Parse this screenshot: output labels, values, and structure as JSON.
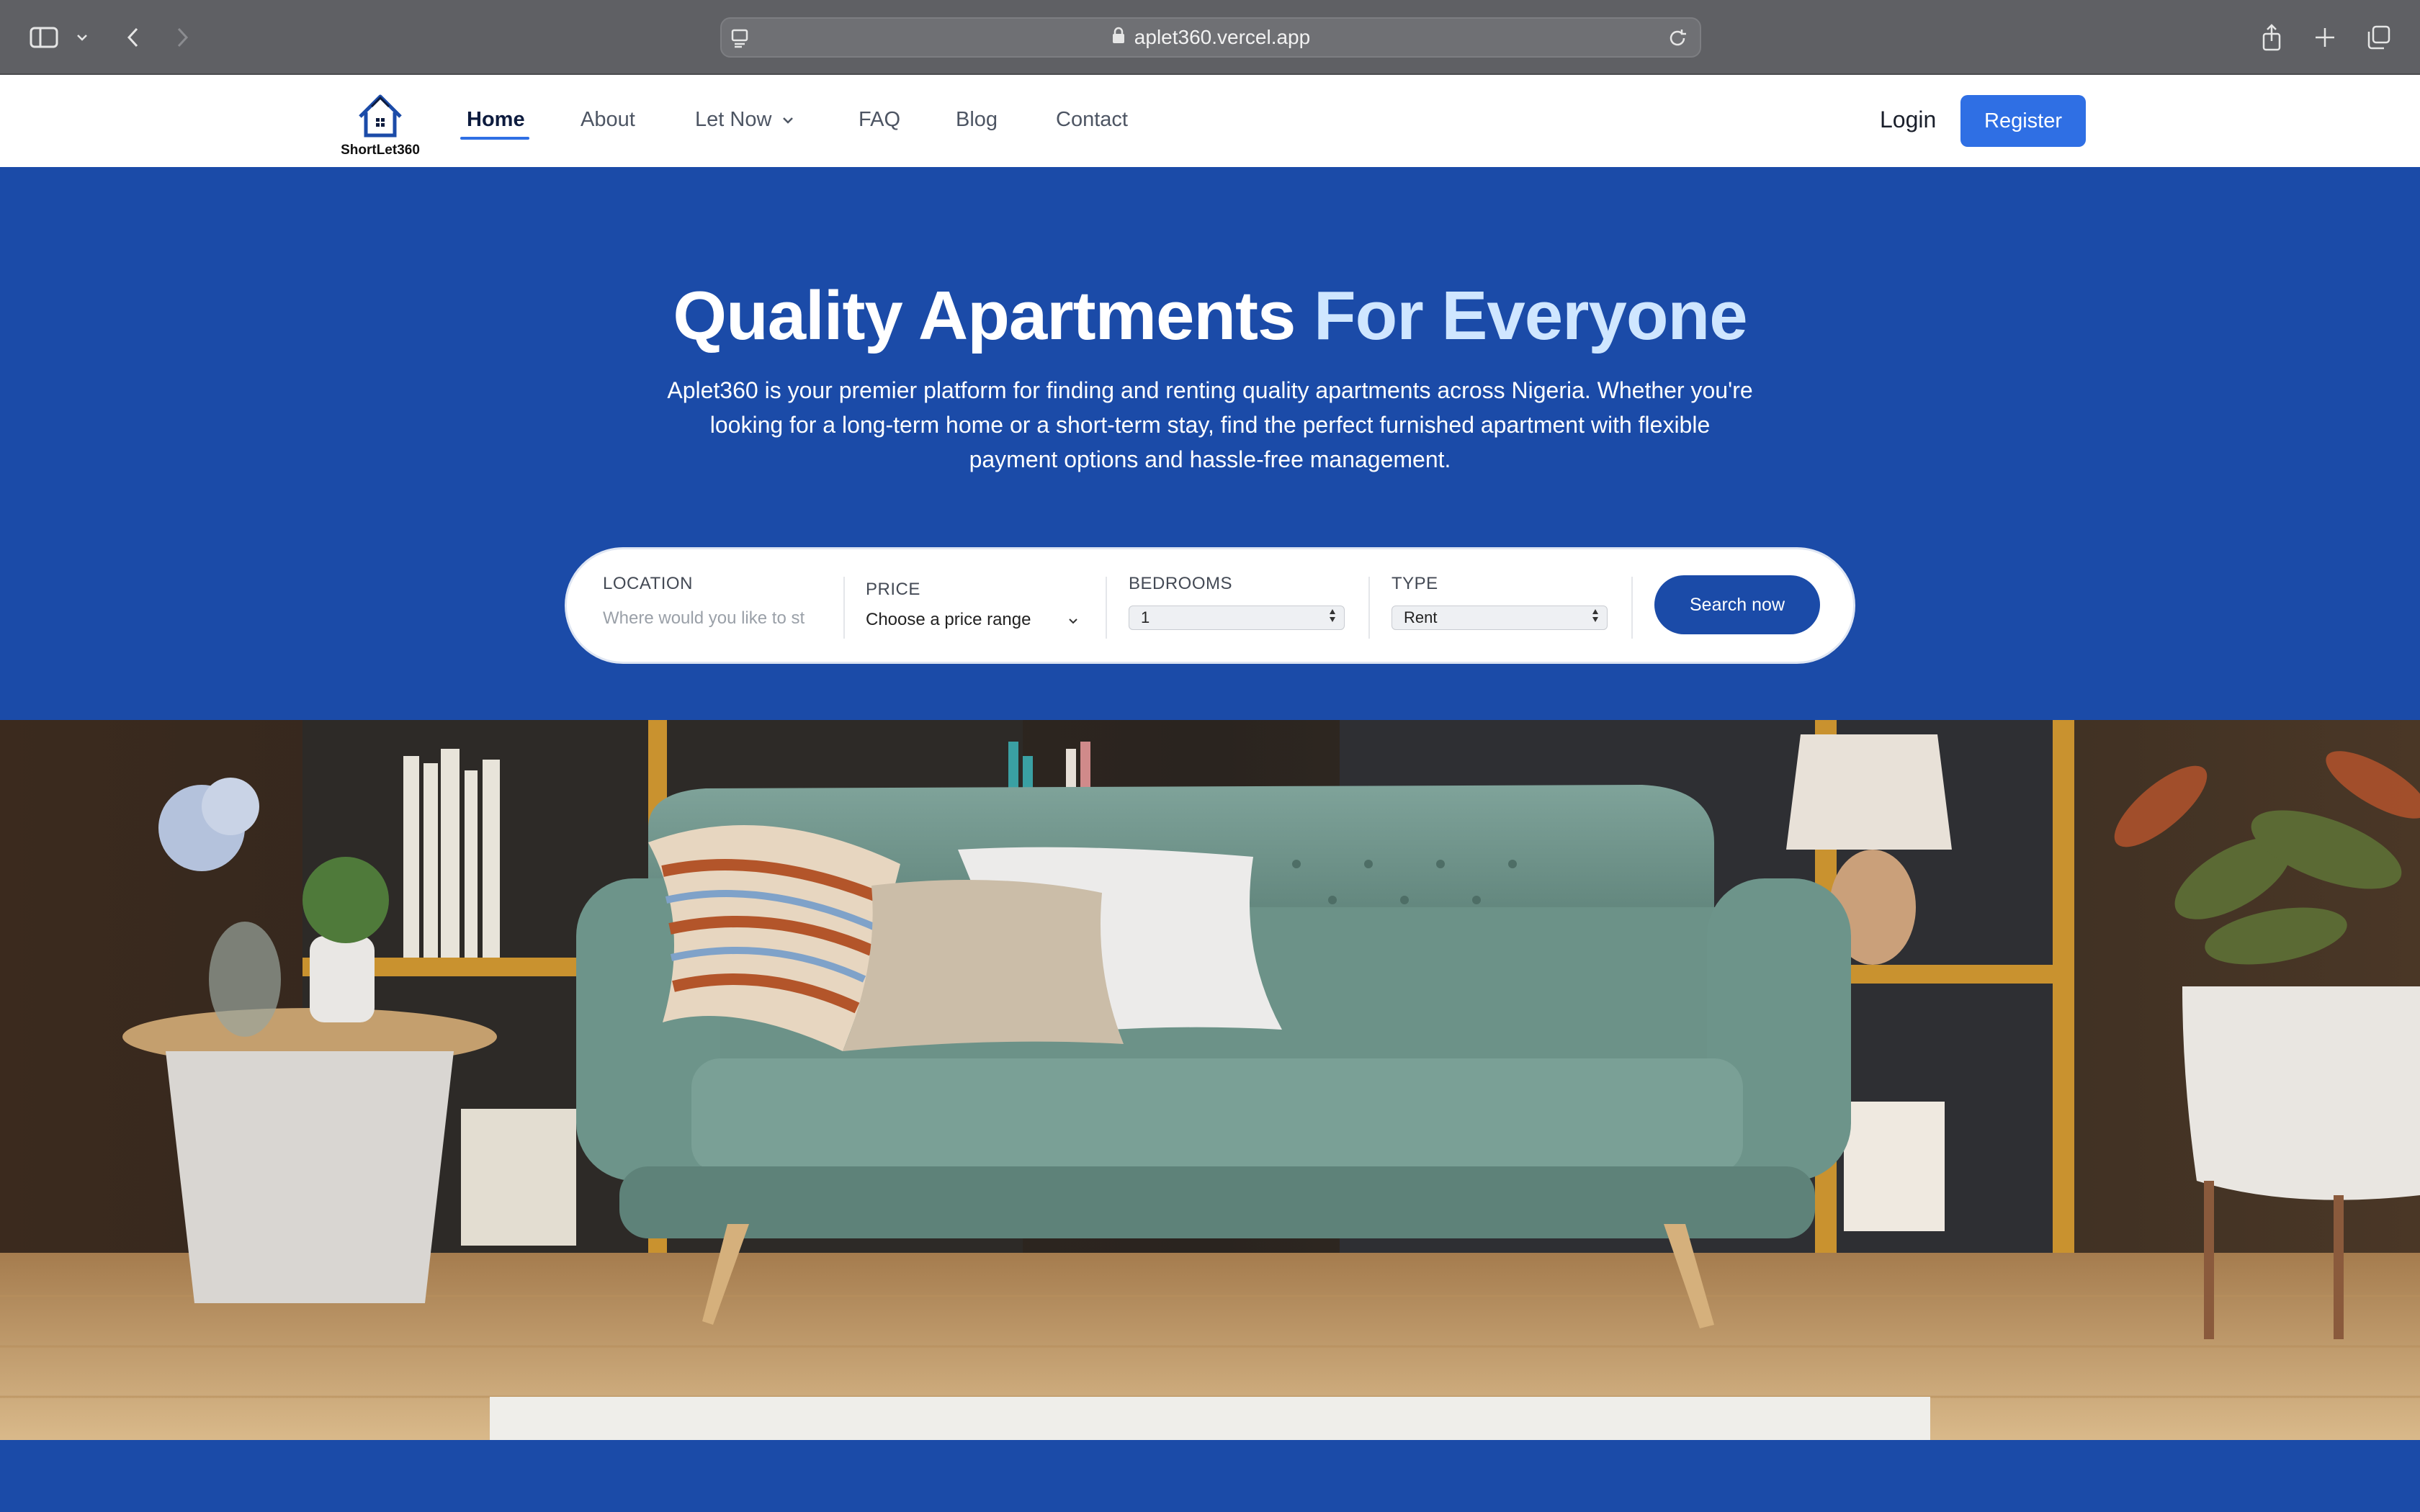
{
  "browser": {
    "url": "aplet360.vercel.app"
  },
  "nav": {
    "logo_text": "ShortLet360",
    "items": [
      {
        "label": "Home"
      },
      {
        "label": "About"
      },
      {
        "label": "Let Now"
      },
      {
        "label": "FAQ"
      },
      {
        "label": "Blog"
      },
      {
        "label": "Contact"
      }
    ],
    "login": "Login",
    "register": "Register"
  },
  "hero": {
    "title_main": "Quality Apartments",
    "title_highlight": "For Everyone",
    "description": "Aplet360 is your premier platform for finding and renting quality apartments across Nigeria. Whether you're looking for a long-term home or a short-term stay, find the perfect furnished apartment with flexible payment options and hassle-free management."
  },
  "search": {
    "location_label": "LOCATION",
    "location_placeholder": "Where would you like to st",
    "price_label": "PRICE",
    "price_value": "Choose a price range",
    "bedrooms_label": "BEDROOMS",
    "bedrooms_value": "1",
    "type_label": "TYPE",
    "type_value": "Rent",
    "button": "Search now"
  },
  "colors": {
    "brand": "#1b4ba8",
    "accent": "#2f6fe4",
    "highlight": "#cfe6ff"
  }
}
